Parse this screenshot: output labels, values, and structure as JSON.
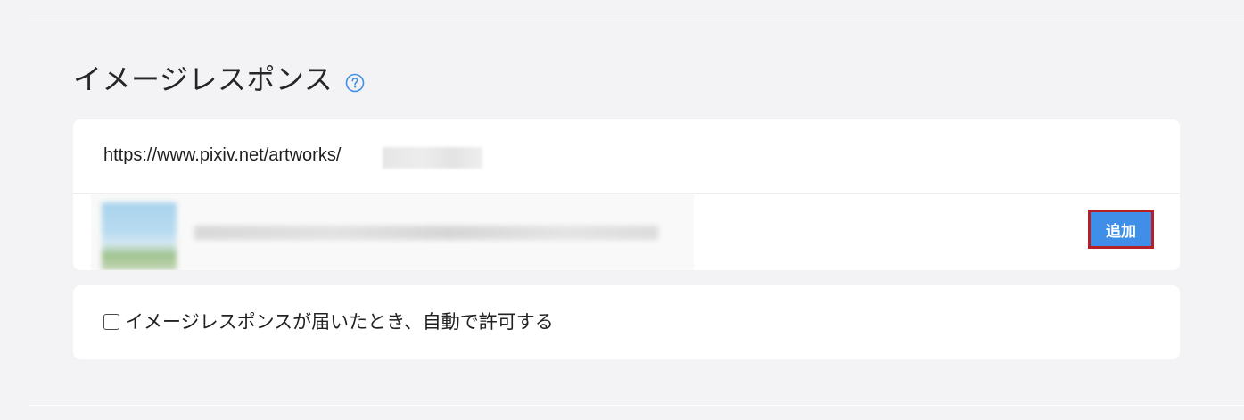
{
  "image_response": {
    "title": "イメージレスポンス",
    "help_icon": "question-circle-icon",
    "url_input": {
      "value": "https://www.pixiv.net/artworks/"
    },
    "add_button_label": "追加",
    "auto_allow_label": "イメージレスポンスが届いたとき、自動で許可する",
    "auto_allow_checked": false
  },
  "colors": {
    "page_background": "#f3f2f5",
    "card_background": "#ffffff",
    "accent": "#3f8fe8",
    "highlight_border": "#b52026"
  }
}
